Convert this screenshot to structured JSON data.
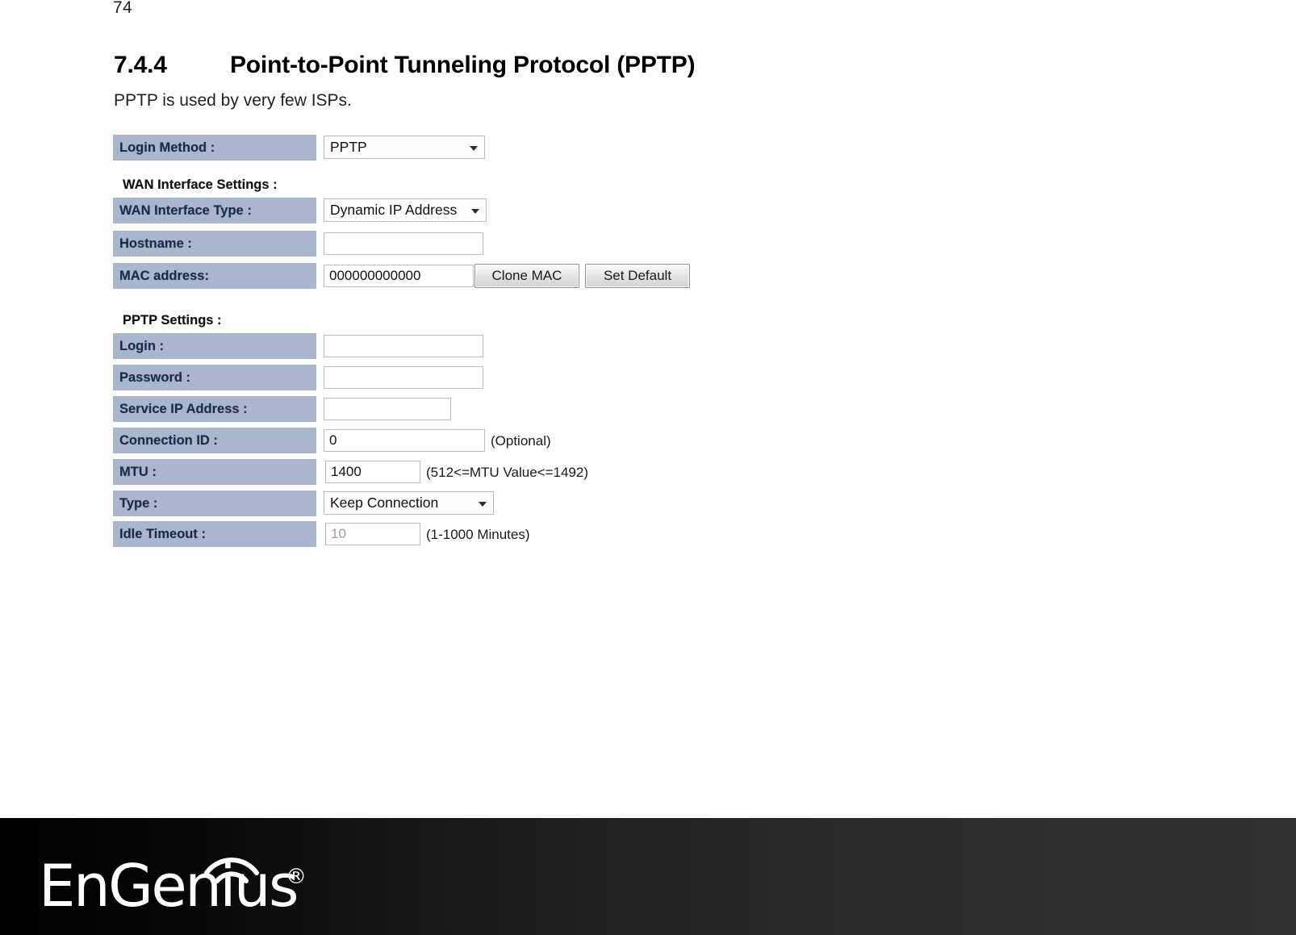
{
  "page": {
    "number": "74"
  },
  "heading": {
    "number": "7.4.4",
    "title": "Point-to-Point Tunneling Protocol (PPTP)"
  },
  "intro": {
    "text": "PPTP is used by very few ISPs."
  },
  "form": {
    "login_method": {
      "label": "Login Method :",
      "value": "PPTP"
    },
    "wan_section": {
      "title": "WAN Interface Settings :"
    },
    "wan_interface_type": {
      "label": "WAN Interface Type :",
      "value": "Dynamic IP Address"
    },
    "hostname": {
      "label": "Hostname :",
      "value": ""
    },
    "mac_address": {
      "label": "MAC address:",
      "value": "000000000000",
      "clone_button": "Clone MAC",
      "default_button": "Set Default"
    },
    "pptp_section": {
      "title": "PPTP Settings :"
    },
    "login": {
      "label": "Login :",
      "value": ""
    },
    "password": {
      "label": "Password :",
      "value": ""
    },
    "service_ip": {
      "label": "Service IP Address :",
      "value": ""
    },
    "connection_id": {
      "label": "Connection ID :",
      "value": "0",
      "hint": "(Optional)"
    },
    "mtu": {
      "label": "MTU :",
      "value": "1400",
      "hint": "(512<=MTU Value<=1492)"
    },
    "type": {
      "label": "Type :",
      "value": "Keep Connection"
    },
    "idle_timeout": {
      "label": "Idle Timeout :",
      "value": "10",
      "hint": "(1-1000 Minutes)"
    }
  },
  "footer": {
    "brand": "EnGenius",
    "registered_mark": "®"
  },
  "colors": {
    "label_bg": "#a9b6cb",
    "label_text": "#1b2a4a",
    "footer_dark": "#000000",
    "footer_light": "#313131"
  }
}
